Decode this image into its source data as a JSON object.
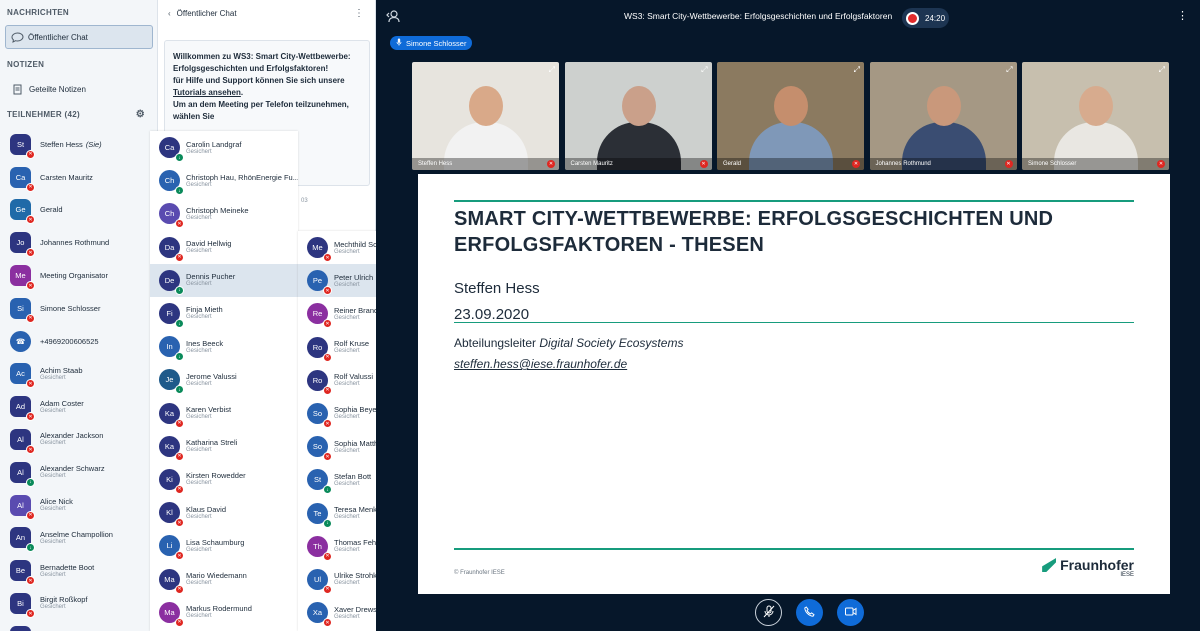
{
  "userlist": {
    "messages_title": "NACHRICHTEN",
    "public_chat": "Öffentlicher Chat",
    "notes_title": "NOTIZEN",
    "shared_notes": "Geteilte Notizen",
    "participants_title": "TEILNEHMER (42)",
    "users": [
      {
        "initials": "St",
        "name": "Steffen Hess",
        "suffix": "(Sie)",
        "sub": "",
        "color": "#2d3580",
        "status": "red"
      },
      {
        "initials": "Ca",
        "name": "Carsten Mauritz",
        "sub": "",
        "color": "#2962b0",
        "status": "red"
      },
      {
        "initials": "Ge",
        "name": "Gerald",
        "sub": "",
        "color": "#1f6aa8",
        "status": "red"
      },
      {
        "initials": "Jo",
        "name": "Johannes Rothmund",
        "sub": "",
        "color": "#2d3580",
        "status": "red"
      },
      {
        "initials": "Me",
        "name": "Meeting Organisator",
        "sub": "",
        "color": "#8b2fa0",
        "status": "red"
      },
      {
        "initials": "Si",
        "name": "Simone Schlosser",
        "sub": "",
        "color": "#2962b0",
        "status": "red"
      },
      {
        "initials": "☎",
        "name": "+4969200606525",
        "sub": "",
        "color": "#2962b0",
        "status": "none"
      },
      {
        "initials": "Ac",
        "name": "Achim Staab",
        "sub": "Gesichert",
        "color": "#2962b0",
        "status": "red"
      },
      {
        "initials": "Ad",
        "name": "Adam Coster",
        "sub": "Gesichert",
        "color": "#2d3580",
        "status": "red"
      },
      {
        "initials": "Al",
        "name": "Alexander Jackson",
        "sub": "Gesichert",
        "color": "#2d3580",
        "status": "red"
      },
      {
        "initials": "Al",
        "name": "Alexander Schwarz",
        "sub": "Gesichert",
        "color": "#2d3580",
        "status": "green"
      },
      {
        "initials": "Al",
        "name": "Alice Nick",
        "sub": "Gesichert",
        "color": "#5a4bb0",
        "status": "red"
      },
      {
        "initials": "An",
        "name": "Anselme Champollion",
        "sub": "Gesichert",
        "color": "#2d3580",
        "status": "green"
      },
      {
        "initials": "Be",
        "name": "Bernadette Boot",
        "sub": "Gesichert",
        "color": "#2d3580",
        "status": "red"
      },
      {
        "initials": "Bi",
        "name": "Birgit Roßkopf",
        "sub": "Gesichert",
        "color": "#2d3580",
        "status": "red"
      },
      {
        "initials": "Ca",
        "name": "Carolin Landgraf",
        "sub": "",
        "color": "#2d3580",
        "status": "none"
      }
    ]
  },
  "chat": {
    "title": "Öffentlicher Chat",
    "welcome_1": "Willkommen zu ",
    "welcome_bold": "WS3: Smart City-Wettbewerbe: Erfolgsgeschichten und Erfolgsfaktoren!",
    "welcome_2": "für Hilfe und Support können Sie sich unsere ",
    "welcome_link": "Tutorials ansehen",
    "welcome_3": ".",
    "welcome_bold2": "Um an dem Meeting per Telefon teilzunehmen, wählen Sie",
    "time_partial": "03"
  },
  "popup1": [
    {
      "initials": "Ca",
      "name": "Carolin Landgraf",
      "sub": "Gesichert",
      "color": "#2d3580",
      "status": "green"
    },
    {
      "initials": "Ch",
      "name": "Christoph Hau, RhönEnergie Fu...",
      "sub": "Gesichert",
      "color": "#2962b0",
      "status": "green"
    },
    {
      "initials": "Ch",
      "name": "Christoph Meineke",
      "sub": "Gesichert",
      "color": "#5a4bb0",
      "status": "red"
    },
    {
      "initials": "Da",
      "name": "David Hellwig",
      "sub": "Gesichert",
      "color": "#2d3580",
      "status": "red"
    },
    {
      "initials": "De",
      "name": "Dennis Pucher",
      "sub": "Gesichert",
      "color": "#2d3580",
      "status": "green",
      "selected": true
    },
    {
      "initials": "Fi",
      "name": "Finja Mieth",
      "sub": "Gesichert",
      "color": "#2d3580",
      "status": "green"
    },
    {
      "initials": "In",
      "name": "Ines Beeck",
      "sub": "Gesichert",
      "color": "#2962b0",
      "status": "green"
    },
    {
      "initials": "Je",
      "name": "Jerome Valussi",
      "sub": "Gesichert",
      "color": "#1e5a8a",
      "status": "green"
    },
    {
      "initials": "Ka",
      "name": "Karen Verbist",
      "sub": "Gesichert",
      "color": "#2d3580",
      "status": "red"
    },
    {
      "initials": "Ka",
      "name": "Katharina Streli",
      "sub": "Gesichert",
      "color": "#2d3580",
      "status": "red"
    },
    {
      "initials": "Ki",
      "name": "Kirsten Rowedder",
      "sub": "Gesichert",
      "color": "#2d3580",
      "status": "red"
    },
    {
      "initials": "Kl",
      "name": "Klaus David",
      "sub": "Gesichert",
      "color": "#2d3580",
      "status": "red"
    },
    {
      "initials": "Li",
      "name": "Lisa Schaumburg",
      "sub": "Gesichert",
      "color": "#2962b0",
      "status": "red"
    },
    {
      "initials": "Ma",
      "name": "Mario Wiedemann",
      "sub": "Gesichert",
      "color": "#2d3580",
      "status": "red"
    },
    {
      "initials": "Ma",
      "name": "Markus Rodermund",
      "sub": "Gesichert",
      "color": "#8b2fa0",
      "status": "red"
    }
  ],
  "popup2": [
    {
      "initials": "Me",
      "name": "Mechthild Schulze Tenberge",
      "sub": "Gesichert",
      "color": "#2d3580",
      "status": "red"
    },
    {
      "initials": "Pe",
      "name": "Peter Ulrich",
      "sub": "Gesichert",
      "color": "#2962b0",
      "status": "red",
      "selected": true
    },
    {
      "initials": "Re",
      "name": "Reiner Brandt",
      "sub": "Gesichert",
      "color": "#8b2fa0",
      "status": "red"
    },
    {
      "initials": "Ro",
      "name": "Rolf Kruse",
      "sub": "Gesichert",
      "color": "#2d3580",
      "status": "red"
    },
    {
      "initials": "Ro",
      "name": "Rolf Valussi",
      "sub": "Gesichert",
      "color": "#2d3580",
      "status": "red"
    },
    {
      "initials": "So",
      "name": "Sophia Beyer",
      "sub": "Gesichert",
      "color": "#2962b0",
      "status": "red"
    },
    {
      "initials": "So",
      "name": "Sophia Matthiesen",
      "sub": "Gesichert",
      "color": "#2962b0",
      "status": "red"
    },
    {
      "initials": "St",
      "name": "Stefan Bott",
      "sub": "Gesichert",
      "color": "#2962b0",
      "status": "green"
    },
    {
      "initials": "Te",
      "name": "Teresa Menke (VKU)",
      "sub": "Gesichert",
      "color": "#2962b0",
      "status": "green"
    },
    {
      "initials": "Th",
      "name": "Thomas Fehling",
      "sub": "Gesichert",
      "color": "#8b2fa0",
      "status": "red"
    },
    {
      "initials": "Ul",
      "name": "Ulrike Strohkark",
      "sub": "Gesichert",
      "color": "#2962b0",
      "status": "red"
    },
    {
      "initials": "Xa",
      "name": "Xaver Drews",
      "sub": "Gesichert",
      "color": "#2962b0",
      "status": "red"
    }
  ],
  "meeting": {
    "title": "WS3: Smart City-Wettbewerbe: Erfolgsgeschichten und Erfolgsfaktoren",
    "recording_time": "24:20",
    "talker": "Simone Schlosser",
    "videos": [
      {
        "name": "Steffen Hess",
        "bg": "#e7e4de",
        "skin": "#d9a989",
        "shirt": "#f2f2f2"
      },
      {
        "name": "Carsten Mauritz",
        "bg": "#cdd0ce",
        "skin": "#caa08a",
        "shirt": "#2b2f36"
      },
      {
        "name": "Gerald",
        "bg": "#8b7a60",
        "skin": "#c58e6d",
        "shirt": "#7f98b8"
      },
      {
        "name": "Johannes Rothmund",
        "bg": "#a59884",
        "skin": "#c9987b",
        "shirt": "#3a4d72"
      },
      {
        "name": "Simone Schlosser",
        "bg": "#c7bfae",
        "skin": "#d7ab8e",
        "shirt": "#e9e7e2"
      }
    ]
  },
  "slide": {
    "title": "SMART CITY-WETTBEWERBE: ERFOLGSGESCHICHTEN UND ERFOLGSFAKTOREN - THESEN",
    "author": "Steffen Hess",
    "date": "23.09.2020",
    "role_prefix": "Abteilungsleiter ",
    "role_italic": "Digital Society Ecosystems",
    "email": "steffen.hess@iese.fraunhofer.de",
    "copyright": "© Fraunhofer IESE",
    "logo_text": "Fraunhofer",
    "logo_sub": "IESE",
    "accent_color": "#179c7d"
  },
  "controls": {
    "mute_icon": "mic-off-icon",
    "phone_icon": "phone-icon",
    "video_icon": "video-icon"
  }
}
